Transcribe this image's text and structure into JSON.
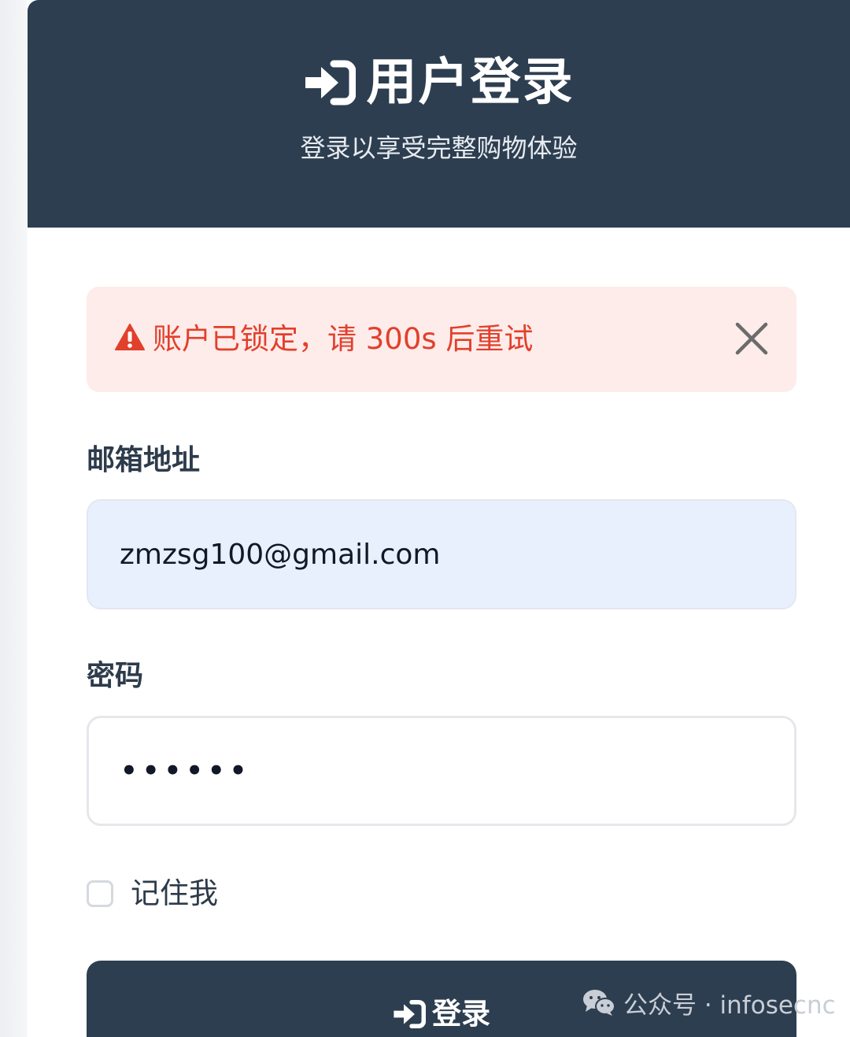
{
  "header": {
    "title": "用户登录",
    "subtitle": "登录以享受完整购物体验",
    "icon": "sign-in-icon"
  },
  "alert": {
    "message": "账户已锁定，请 300s 后重试",
    "icon": "warning-triangle-icon",
    "close_icon": "close-icon"
  },
  "form": {
    "email_label": "邮箱地址",
    "email_value": "zmzsg100@gmail.com",
    "password_label": "密码",
    "password_value": "••••••",
    "remember_label": "记住我",
    "remember_checked": false,
    "submit_label": "登录",
    "submit_icon": "sign-in-icon"
  },
  "watermark": {
    "text": "公众号 · infosecnc",
    "icon": "wechat-icon"
  },
  "colors": {
    "header_bg": "#2d3e50",
    "alert_bg": "#fdecea",
    "alert_text": "#e2402c",
    "email_input_bg": "#e8f0fe",
    "label_text": "#2d3b4b"
  }
}
